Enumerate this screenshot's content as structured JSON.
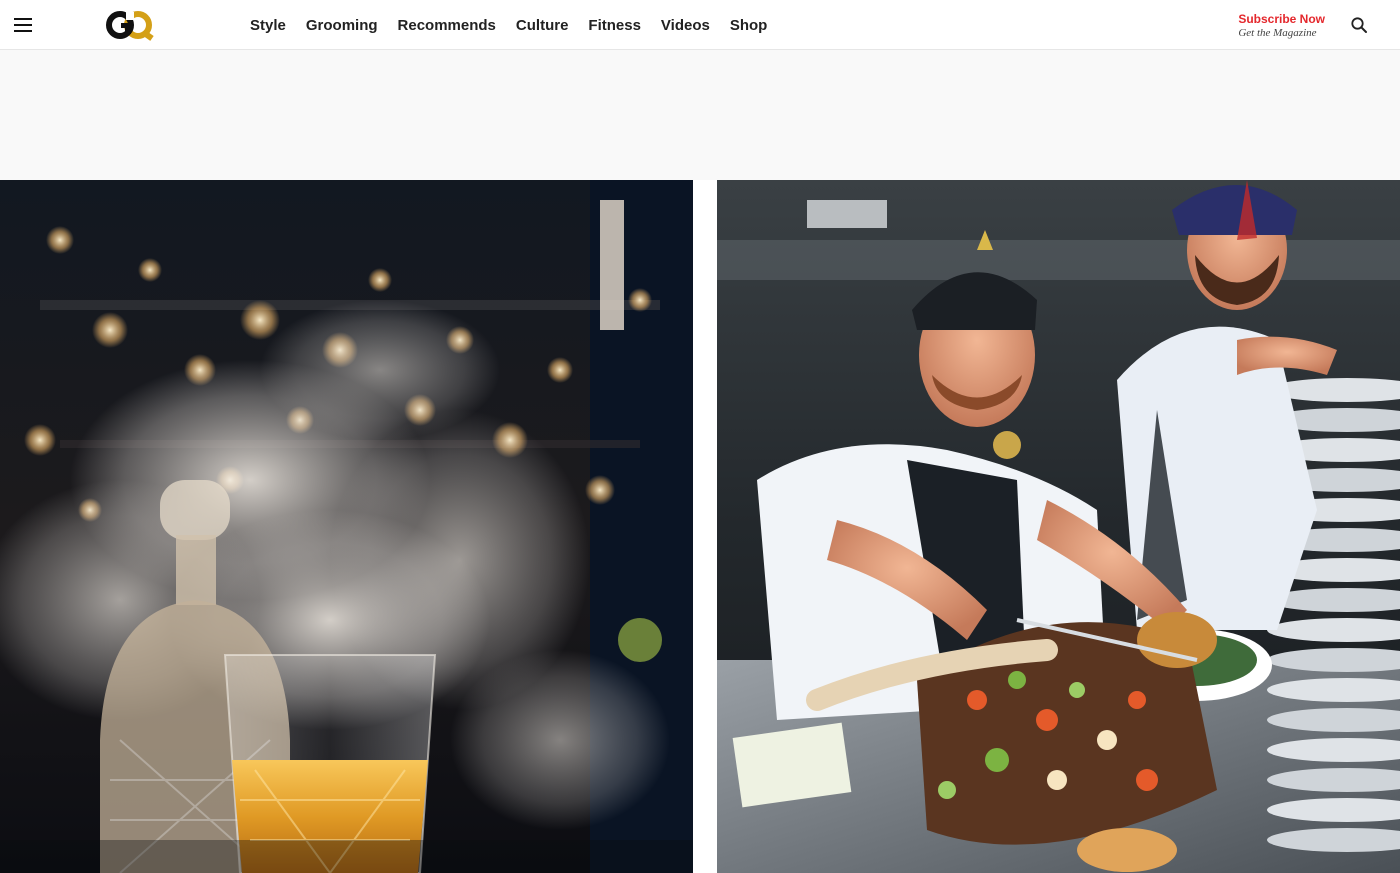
{
  "header": {
    "logo_text": "GQ",
    "nav": [
      {
        "label": "Style"
      },
      {
        "label": "Grooming"
      },
      {
        "label": "Recommends"
      },
      {
        "label": "Culture"
      },
      {
        "label": "Fitness"
      },
      {
        "label": "Videos"
      },
      {
        "label": "Shop"
      }
    ],
    "subscribe": {
      "title": "Subscribe Now",
      "subtitle": "Get the Magazine"
    },
    "icons": {
      "menu": "hamburger-menu-icon",
      "search": "search-icon"
    }
  },
  "colors": {
    "accent_red": "#e4282d",
    "logo_gold": "#d4a017",
    "text": "#222222",
    "ad_background": "#f9f9f9"
  },
  "gallery": {
    "images": [
      {
        "subject": "whiskey-glass-with-smoke"
      },
      {
        "subject": "chefs-plating-tomahawk-steak"
      }
    ]
  }
}
